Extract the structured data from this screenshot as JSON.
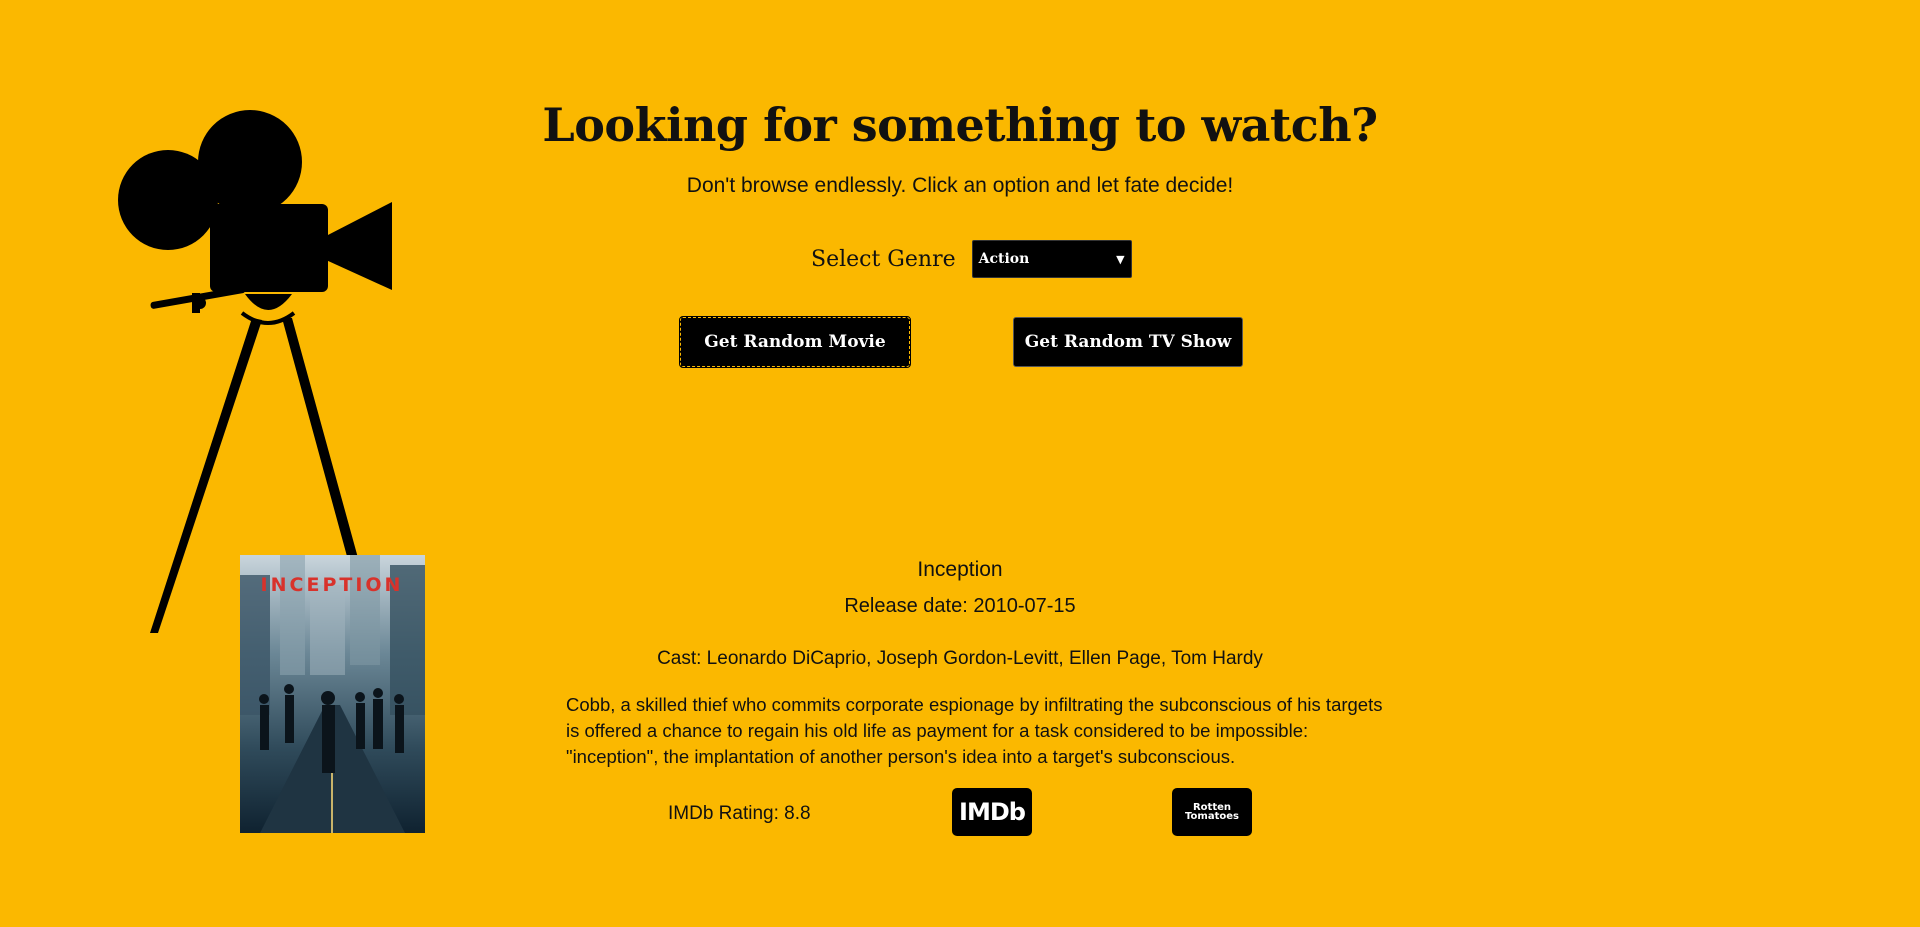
{
  "header": {
    "title": "Looking for something to watch?",
    "subtitle": "Don't browse endlessly. Click an option and let fate decide!"
  },
  "genre": {
    "label": "Select Genre",
    "selected": "Action"
  },
  "buttons": {
    "movie": "Get Random Movie",
    "tv": "Get Random TV Show"
  },
  "result": {
    "title": "Inception",
    "release": "Release date: 2010-07-15",
    "cast": "Cast: Leonardo DiCaprio, Joseph Gordon-Levitt, Ellen Page, Tom Hardy",
    "plot": "Cobb, a skilled thief who commits corporate espionage by infiltrating the subconscious of his targets is offered a chance to regain his old life as payment for a task considered to be impossible: \"inception\", the implantation of another person's idea into a target's subconscious.",
    "imdb_rating": "IMDb Rating: 8.8",
    "poster_text": "INCEPTION"
  },
  "logos": {
    "imdb": "IMDb",
    "rt_line1": "Rotten",
    "rt_line2": "Tomatoes"
  },
  "colors": {
    "background": "#FBB800",
    "button": "#000000",
    "poster_title": "#D8322B"
  },
  "icons": {
    "camera": "film-camera-icon"
  }
}
